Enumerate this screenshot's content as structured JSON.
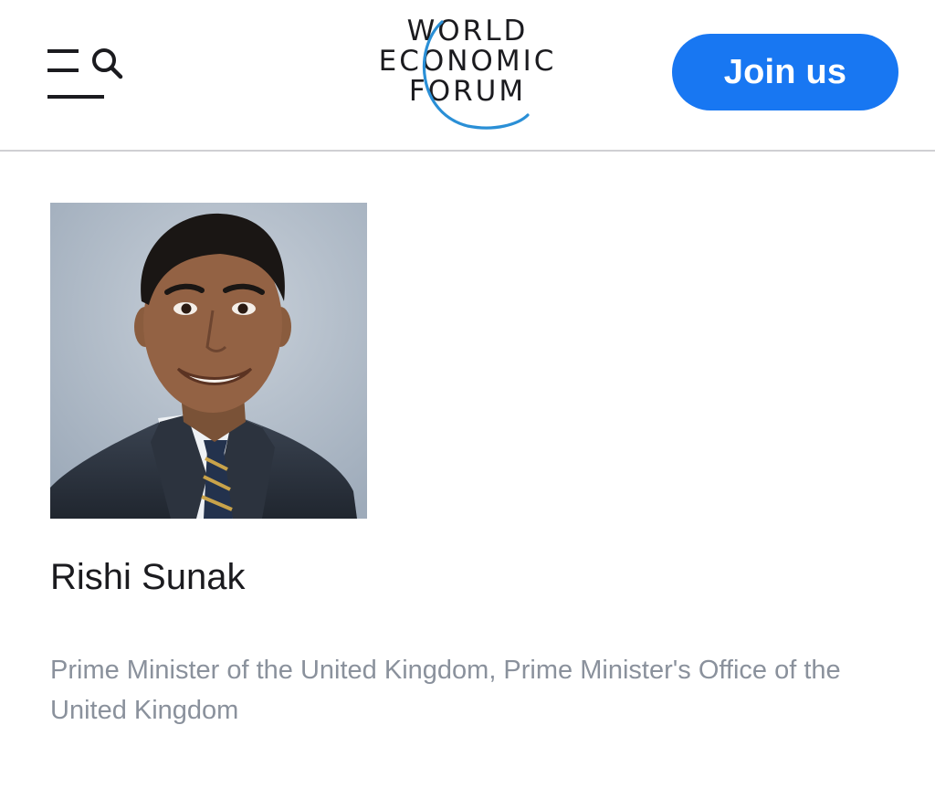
{
  "header": {
    "menu_icon": "menu-icon",
    "search_icon": "search-icon",
    "logo": {
      "line1": "WORLD",
      "line2": "ECONOMIC",
      "line3": "FORUM"
    },
    "join_label": "Join us"
  },
  "profile": {
    "photo_icon": "portrait-photo",
    "name": "Rishi Sunak",
    "position": "Prime Minister of the United Kingdom, Prime Minister's Office of the United Kingdom"
  },
  "colors": {
    "accent": "#1877f2",
    "logo_text": "#1b1b1f",
    "logo_arc": "#2a8fd6",
    "muted_text": "#8a919c",
    "divider": "#cfcfd3"
  }
}
